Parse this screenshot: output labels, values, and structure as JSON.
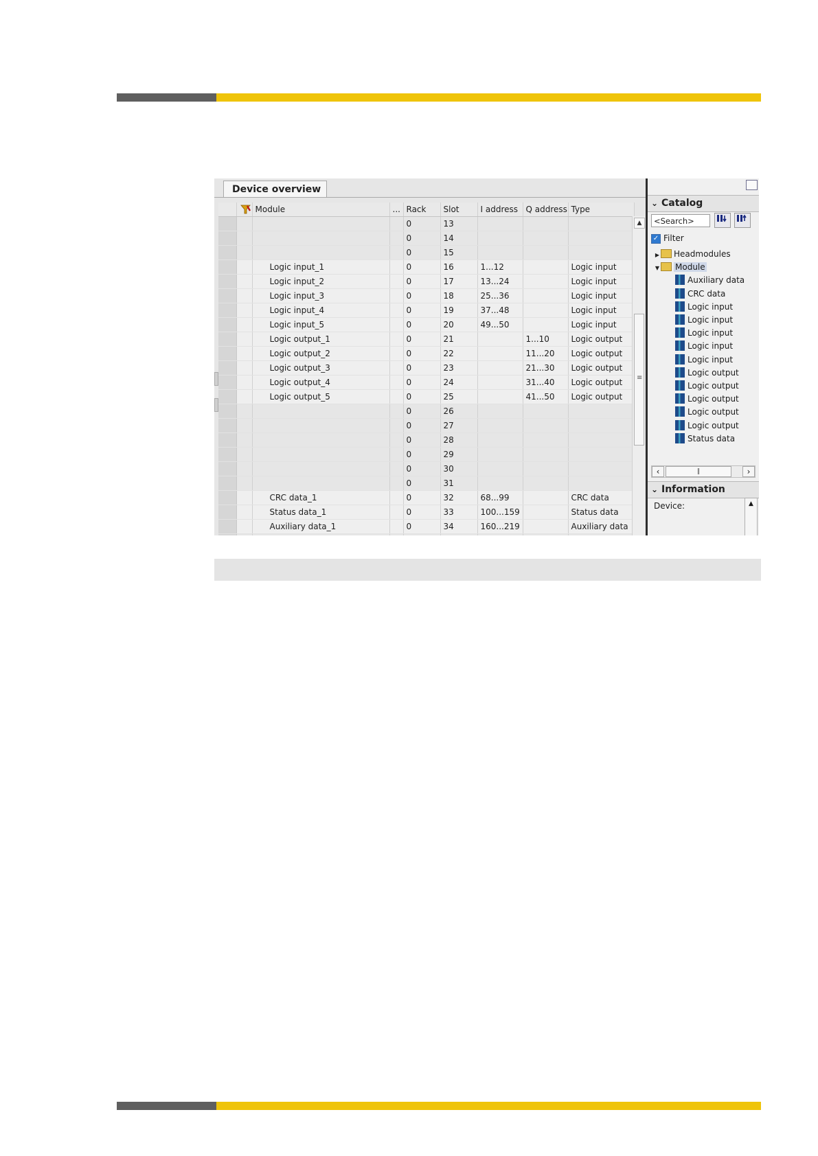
{
  "device_overview": {
    "tab_title": "Device overview",
    "columns": [
      "Module",
      "...",
      "Rack",
      "Slot",
      "I address",
      "Q address",
      "Type"
    ],
    "rows": [
      {
        "module": "",
        "rack": "0",
        "slot": "13",
        "i_address": "",
        "q_address": "",
        "type": ""
      },
      {
        "module": "",
        "rack": "0",
        "slot": "14",
        "i_address": "",
        "q_address": "",
        "type": ""
      },
      {
        "module": "",
        "rack": "0",
        "slot": "15",
        "i_address": "",
        "q_address": "",
        "type": ""
      },
      {
        "module": "Logic input_1",
        "rack": "0",
        "slot": "16",
        "i_address": "1...12",
        "q_address": "",
        "type": "Logic input"
      },
      {
        "module": "Logic input_2",
        "rack": "0",
        "slot": "17",
        "i_address": "13...24",
        "q_address": "",
        "type": "Logic input"
      },
      {
        "module": "Logic input_3",
        "rack": "0",
        "slot": "18",
        "i_address": "25...36",
        "q_address": "",
        "type": "Logic input"
      },
      {
        "module": "Logic input_4",
        "rack": "0",
        "slot": "19",
        "i_address": "37...48",
        "q_address": "",
        "type": "Logic input"
      },
      {
        "module": "Logic input_5",
        "rack": "0",
        "slot": "20",
        "i_address": "49...50",
        "q_address": "",
        "type": "Logic input"
      },
      {
        "module": "Logic output_1",
        "rack": "0",
        "slot": "21",
        "i_address": "",
        "q_address": "1...10",
        "type": "Logic output"
      },
      {
        "module": "Logic output_2",
        "rack": "0",
        "slot": "22",
        "i_address": "",
        "q_address": "11...20",
        "type": "Logic output"
      },
      {
        "module": "Logic output_3",
        "rack": "0",
        "slot": "23",
        "i_address": "",
        "q_address": "21...30",
        "type": "Logic output"
      },
      {
        "module": "Logic output_4",
        "rack": "0",
        "slot": "24",
        "i_address": "",
        "q_address": "31...40",
        "type": "Logic output"
      },
      {
        "module": "Logic output_5",
        "rack": "0",
        "slot": "25",
        "i_address": "",
        "q_address": "41...50",
        "type": "Logic output"
      },
      {
        "module": "",
        "rack": "0",
        "slot": "26",
        "i_address": "",
        "q_address": "",
        "type": ""
      },
      {
        "module": "",
        "rack": "0",
        "slot": "27",
        "i_address": "",
        "q_address": "",
        "type": ""
      },
      {
        "module": "",
        "rack": "0",
        "slot": "28",
        "i_address": "",
        "q_address": "",
        "type": ""
      },
      {
        "module": "",
        "rack": "0",
        "slot": "29",
        "i_address": "",
        "q_address": "",
        "type": ""
      },
      {
        "module": "",
        "rack": "0",
        "slot": "30",
        "i_address": "",
        "q_address": "",
        "type": ""
      },
      {
        "module": "",
        "rack": "0",
        "slot": "31",
        "i_address": "",
        "q_address": "",
        "type": ""
      },
      {
        "module": "CRC data_1",
        "rack": "0",
        "slot": "32",
        "i_address": "68...99",
        "q_address": "",
        "type": "CRC data"
      },
      {
        "module": "Status data_1",
        "rack": "0",
        "slot": "33",
        "i_address": "100...159",
        "q_address": "",
        "type": "Status data"
      },
      {
        "module": "Auxiliary data_1",
        "rack": "0",
        "slot": "34",
        "i_address": "160...219",
        "q_address": "",
        "type": "Auxiliary data"
      },
      {
        "module": "",
        "rack": "",
        "slot": "",
        "i_address": "",
        "q_address": "",
        "type": ""
      }
    ]
  },
  "catalog": {
    "title": "Catalog",
    "search_placeholder": "<Search>",
    "filter_label": "Filter",
    "filter_checked": true,
    "tree": [
      {
        "label": "Headmodules",
        "kind": "folder",
        "expanded": false,
        "depth": 0
      },
      {
        "label": "Module",
        "kind": "folder",
        "expanded": true,
        "depth": 0,
        "selected": true
      },
      {
        "label": "Auxiliary data",
        "kind": "module",
        "depth": 1
      },
      {
        "label": "CRC data",
        "kind": "module",
        "depth": 1
      },
      {
        "label": "Logic input",
        "kind": "module",
        "depth": 1
      },
      {
        "label": "Logic input",
        "kind": "module",
        "depth": 1
      },
      {
        "label": "Logic input",
        "kind": "module",
        "depth": 1
      },
      {
        "label": "Logic input",
        "kind": "module",
        "depth": 1
      },
      {
        "label": "Logic input",
        "kind": "module",
        "depth": 1
      },
      {
        "label": "Logic output",
        "kind": "module",
        "depth": 1
      },
      {
        "label": "Logic output",
        "kind": "module",
        "depth": 1
      },
      {
        "label": "Logic output",
        "kind": "module",
        "depth": 1
      },
      {
        "label": "Logic output",
        "kind": "module",
        "depth": 1
      },
      {
        "label": "Logic output",
        "kind": "module",
        "depth": 1
      },
      {
        "label": "Status data",
        "kind": "module",
        "depth": 1
      }
    ]
  },
  "information": {
    "title": "Information",
    "device_label": "Device:"
  },
  "colors": {
    "accent_yellow": "#efc40a",
    "accent_grey": "#5f5f5f"
  }
}
